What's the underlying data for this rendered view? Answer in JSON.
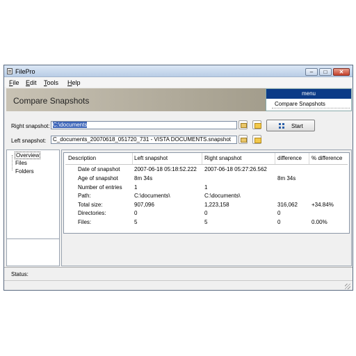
{
  "window": {
    "title": "FilePro",
    "minimize": "–",
    "maximize": "□",
    "close": "✕"
  },
  "menubar": [
    {
      "label": "File",
      "key": "F",
      "rest": "ile"
    },
    {
      "label": "Edit",
      "key": "E",
      "rest": "dit"
    },
    {
      "label": "Tools",
      "key": "T",
      "rest": "ools"
    },
    {
      "label": "Help",
      "key": "H",
      "rest": "elp"
    }
  ],
  "banner": {
    "title": "Compare Snapshots"
  },
  "side_menu": {
    "header": "menu",
    "item": "Compare Snapshots"
  },
  "right_snapshot": {
    "label": "Right snapshot:",
    "value": "C:\\documents"
  },
  "left_snapshot": {
    "label": "Left snapshot:",
    "value": "C_documents_20070618_051720_731 - VISTA DOCUMENTS.snapshot"
  },
  "start_button": {
    "label": "Start"
  },
  "nav": [
    "Overview",
    "Files",
    "Folders"
  ],
  "table": {
    "headers": [
      "Description",
      "Left snapshot",
      "Right snapshot",
      "difference",
      "% difference"
    ],
    "rows": [
      [
        "Date of snapshot",
        "2007-06-18 05:18:52.222",
        "2007-06-18 05:27:26.562",
        "",
        ""
      ],
      [
        "Age of snapshot",
        "8m 34s",
        "",
        "8m 34s",
        ""
      ],
      [
        "Number of entries",
        "1",
        "1",
        "",
        ""
      ],
      [
        "Path:",
        "C:\\documents\\",
        "C:\\documents\\",
        "",
        ""
      ],
      [
        "Total size:",
        "907,096",
        "1,223,158",
        "316,062",
        "+34.84%"
      ],
      [
        "Directories:",
        "0",
        "0",
        "0",
        ""
      ],
      [
        "Files:",
        "5",
        "5",
        "0",
        "0.00%"
      ]
    ]
  },
  "status": {
    "label": "Status:"
  },
  "icons": [
    "app-icon",
    "refresh-icon",
    "folder-icon",
    "start-icon",
    "resize-grip-icon"
  ]
}
